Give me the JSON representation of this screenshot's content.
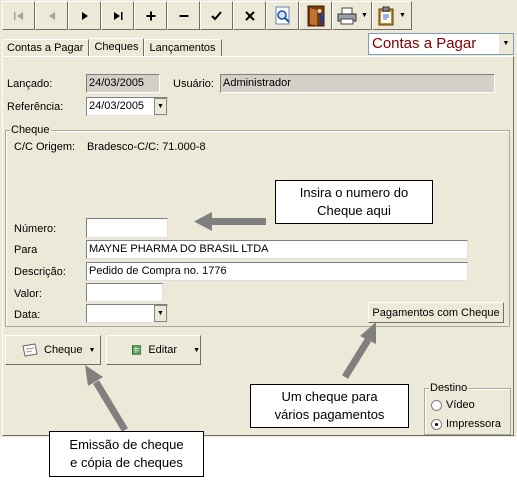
{
  "toolbar": {
    "buttons": [
      {
        "icon": "first-record-icon",
        "glyph": "|◂",
        "enabled": false
      },
      {
        "icon": "prev-record-icon",
        "glyph": "◂",
        "enabled": false
      },
      {
        "icon": "next-record-icon",
        "glyph": "▸",
        "enabled": true
      },
      {
        "icon": "last-record-icon",
        "glyph": "▸|",
        "enabled": true
      },
      {
        "icon": "add-icon",
        "glyph": "+",
        "enabled": true
      },
      {
        "icon": "remove-icon",
        "glyph": "−",
        "enabled": true
      },
      {
        "icon": "confirm-icon",
        "glyph": "✔",
        "enabled": true
      },
      {
        "icon": "cancel-icon",
        "glyph": "✕",
        "enabled": true
      },
      {
        "icon": "search-icon",
        "enabled": true
      },
      {
        "icon": "exit-door-icon",
        "enabled": true
      },
      {
        "icon": "printer-icon",
        "enabled": true
      },
      {
        "icon": "clipboard-icon",
        "enabled": true
      }
    ]
  },
  "tabs": [
    "Contas a Pagar",
    "Cheques",
    "Lançamentos"
  ],
  "active_tab": 1,
  "mode_select": {
    "value": "Contas a Pagar"
  },
  "header": {
    "lancado_label": "Lançado:",
    "lancado_value": "24/03/2005",
    "usuario_label": "Usuário:",
    "usuario_value": "Administrador",
    "referencia_label": "Referência:",
    "referencia_value": "24/03/2005"
  },
  "cheque": {
    "group_title": "Cheque",
    "cc_origem_label": "C/C Origem:",
    "cc_origem_value": "Bradesco-C/C: 71.000-8",
    "numero_label": "Número:",
    "numero_value": "",
    "para_label": "Para",
    "para_value": "MAYNE PHARMA DO BRASIL LTDA",
    "descricao_label": "Descrição:",
    "descricao_value": "Pedido de Compra no. 1776",
    "valor_label": "Valor:",
    "valor_value": "",
    "data_label": "Data:",
    "data_value": "",
    "pagamentos_button": "Pagamentos com Cheque"
  },
  "actions": {
    "cheque_button": "Cheque",
    "editar_button": "Editar"
  },
  "destino": {
    "title": "Destino",
    "options": [
      "Vídeo",
      "Impressora"
    ],
    "selected": "Impressora"
  },
  "callouts": {
    "numero_hint": [
      "Insira o numero do",
      "Cheque aqui"
    ],
    "pagamentos_hint": [
      "Um cheque para",
      "vários pagamentos"
    ],
    "emissao_hint": [
      "Emissão de cheque",
      "e cópia de cheques"
    ]
  },
  "colors": {
    "window_bg": "#ece9d8",
    "mode_text": "#800000",
    "arrow": "#808080"
  }
}
